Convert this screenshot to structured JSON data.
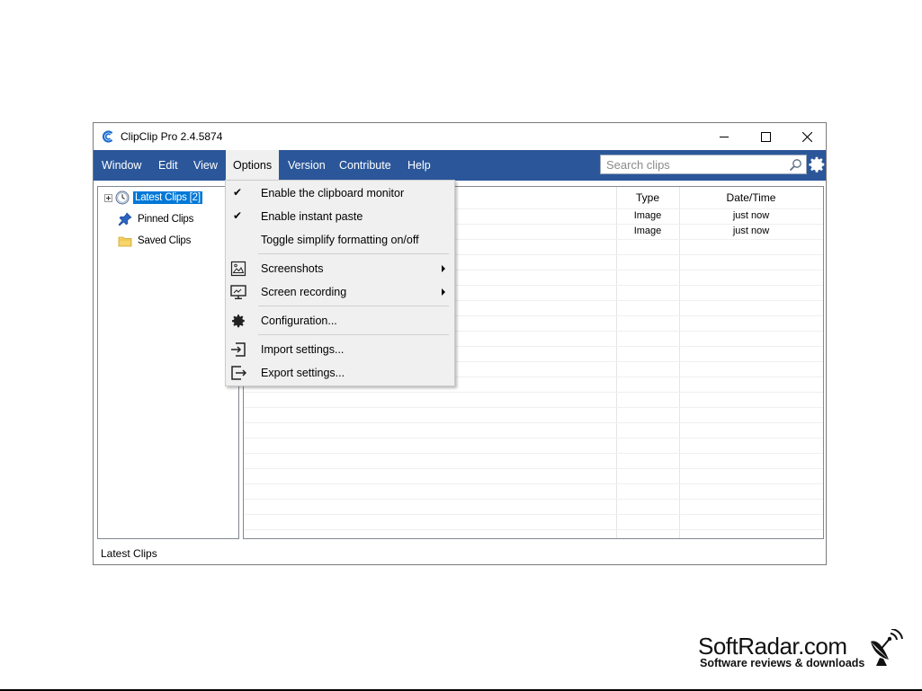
{
  "window": {
    "title": "ClipClip Pro 2.4.5874"
  },
  "menubar": {
    "items": [
      {
        "label": "Window"
      },
      {
        "label": "Edit"
      },
      {
        "label": "View"
      },
      {
        "label": "Options"
      },
      {
        "label": "Version"
      },
      {
        "label": "Contribute"
      },
      {
        "label": "Help"
      }
    ],
    "active": "Options"
  },
  "search": {
    "placeholder": "Search clips",
    "value": ""
  },
  "tree": {
    "items": [
      {
        "label": "Latest Clips [2]",
        "icon": "clock-icon",
        "selected": true
      },
      {
        "label": "Pinned Clips",
        "icon": "pin-icon"
      },
      {
        "label": "Saved Clips",
        "icon": "folder-icon"
      }
    ]
  },
  "list": {
    "columns": [
      {
        "label": ""
      },
      {
        "label": "Type"
      },
      {
        "label": "Date/Time"
      }
    ],
    "rows": [
      {
        "type": "Image",
        "datetime": "just now"
      },
      {
        "type": "Image",
        "datetime": "just now"
      }
    ]
  },
  "status": {
    "text": "Latest Clips"
  },
  "options_menu": {
    "items": [
      {
        "label": "Enable the clipboard monitor",
        "checked": true
      },
      {
        "label": "Enable instant paste",
        "checked": true
      },
      {
        "label": "Toggle simplify formatting on/off"
      },
      {
        "label": "Screenshots",
        "icon": "screenshot-icon",
        "submenu": true
      },
      {
        "label": "Screen recording",
        "icon": "screen-recording-icon",
        "submenu": true
      },
      {
        "label": "Configuration...",
        "icon": "gear-icon"
      },
      {
        "label": "Import settings...",
        "icon": "import-icon"
      },
      {
        "label": "Export settings...",
        "icon": "export-icon"
      }
    ]
  },
  "watermark": {
    "name": "SoftRadar.com",
    "tagline": "Software reviews & downloads"
  },
  "colors": {
    "menubar": "#2b579a",
    "selection": "#0078d7",
    "menu_bg": "#f0f0f0"
  }
}
